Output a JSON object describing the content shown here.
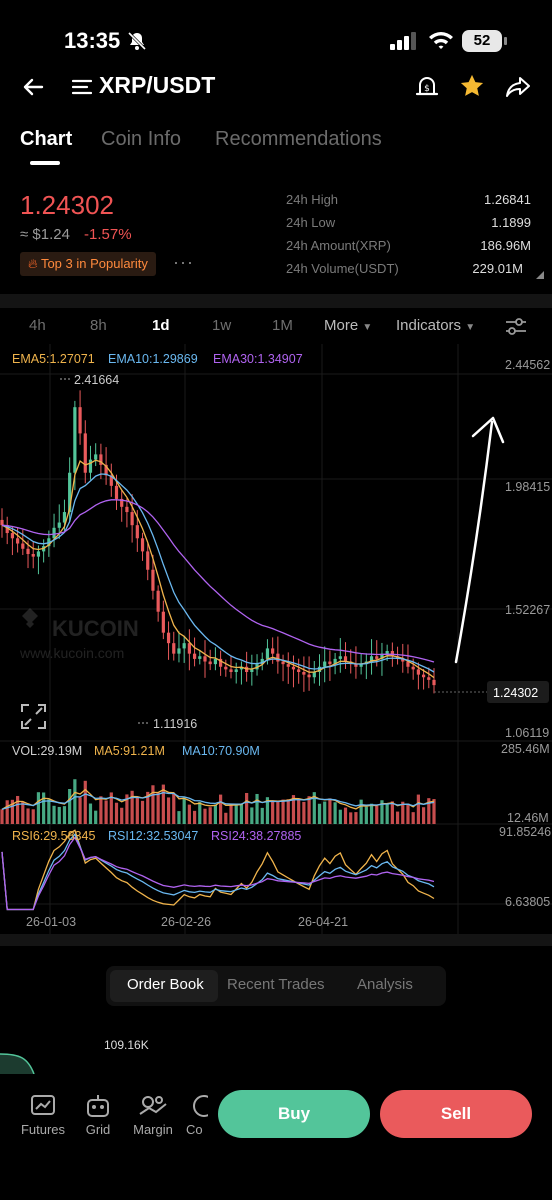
{
  "status_bar": {
    "time": "13:35",
    "battery": "52"
  },
  "header": {
    "title": "XRP/USDT"
  },
  "tabs": [
    "Chart",
    "Coin Info",
    "Recommendations"
  ],
  "ticker": {
    "last_price": "1.24302",
    "usd_price": "≈ $1.24",
    "change": "-1.57%",
    "badge": "Top 3 in Popularity",
    "more": "···",
    "stats": [
      {
        "label": "24h High",
        "value": "1.26841"
      },
      {
        "label": "24h Low",
        "value": "1.1899"
      },
      {
        "label": "24h Amount(XRP)",
        "value": "186.96M"
      },
      {
        "label": "24h Volume(USDT)",
        "value": "229.01M"
      }
    ]
  },
  "timeframes": [
    "4h",
    "8h",
    "1d",
    "1w",
    "1M"
  ],
  "timeframe_more": "More",
  "indicators_label": "Indicators",
  "watermark": {
    "brand": "KUCOIN",
    "url": "www.kucoin.com"
  },
  "chart_data": {
    "type": "line",
    "price_legend": [
      {
        "label": "EMA5:1.27071",
        "color": "#f0b44c"
      },
      {
        "label": "EMA10:1.29869",
        "color": "#6ab8f0"
      },
      {
        "label": "EMA30:1.34907",
        "color": "#b063f0"
      }
    ],
    "price_axis_ticks": [
      "2.44562",
      "1.98415",
      "1.52267",
      "1.06119"
    ],
    "current_price_tag": "1.24302",
    "max_label": "2.41664",
    "min_label": "1.11916",
    "vol_legend": [
      {
        "label": "VOL:29.19M",
        "color": "#cfcfcf"
      },
      {
        "label": "MA5:91.21M",
        "color": "#f0b44c"
      },
      {
        "label": "MA10:70.90M",
        "color": "#6ab8f0"
      }
    ],
    "vol_axis_ticks": [
      "285.46M",
      "12.46M"
    ],
    "rsi_legend": [
      {
        "label": "RSI6:29.58345",
        "color": "#f0b44c"
      },
      {
        "label": "RSI12:32.53047",
        "color": "#6ab8f0"
      },
      {
        "label": "RSI24:38.27885",
        "color": "#b063f0"
      }
    ],
    "rsi_axis_ticks": [
      "91.85246",
      "6.63805"
    ],
    "x_ticks": [
      "26-01-03",
      "26-02-26",
      "26-04-21"
    ],
    "close_series": [
      1.85,
      1.82,
      1.8,
      1.78,
      1.76,
      1.74,
      1.73,
      1.75,
      1.77,
      1.8,
      1.84,
      1.86,
      1.9,
      2.05,
      2.3,
      2.2,
      2.05,
      2.1,
      2.12,
      2.08,
      2.04,
      2.0,
      1.95,
      1.92,
      1.9,
      1.85,
      1.8,
      1.75,
      1.68,
      1.6,
      1.52,
      1.44,
      1.4,
      1.36,
      1.38,
      1.4,
      1.36,
      1.34,
      1.35,
      1.33,
      1.32,
      1.34,
      1.31,
      1.3,
      1.29,
      1.3,
      1.31,
      1.29,
      1.3,
      1.32,
      1.34,
      1.38,
      1.36,
      1.33,
      1.32,
      1.31,
      1.3,
      1.29,
      1.28,
      1.27,
      1.29,
      1.31,
      1.33,
      1.32,
      1.34,
      1.35,
      1.33,
      1.32,
      1.31,
      1.32,
      1.33,
      1.35,
      1.34,
      1.36,
      1.37,
      1.35,
      1.34,
      1.33,
      1.31,
      1.3,
      1.28,
      1.27,
      1.26,
      1.24
    ]
  },
  "order_book_tabs": [
    "Order Book",
    "Recent Trades",
    "Analysis"
  ],
  "depth_value": "109.16K",
  "bottom_nav": [
    "Futures",
    "Grid",
    "Margin",
    "Co"
  ],
  "actions": {
    "buy": "Buy",
    "sell": "Sell"
  },
  "colors": {
    "up": "#53c59a",
    "down": "#ea5a5c",
    "accent": "#f0b44c"
  }
}
